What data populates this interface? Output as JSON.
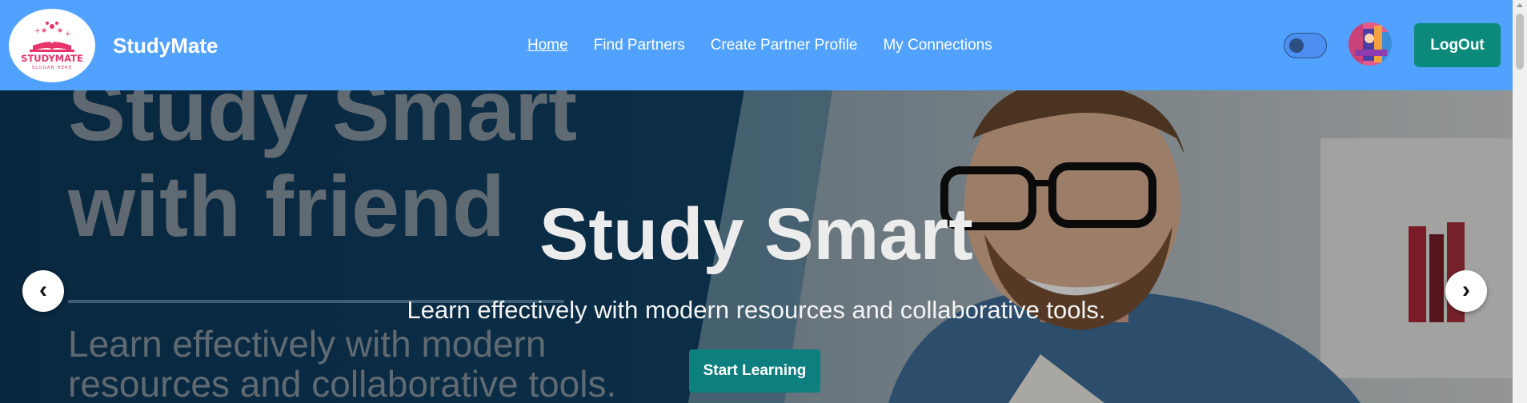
{
  "brand": {
    "name": "StudyMate",
    "logo_title": "STUDYMATE",
    "logo_slogan": "SLOGAN HERE"
  },
  "nav": {
    "items": [
      {
        "label": "Home",
        "active": true
      },
      {
        "label": "Find Partners",
        "active": false
      },
      {
        "label": "Create Partner Profile",
        "active": false
      },
      {
        "label": "My Connections",
        "active": false
      }
    ]
  },
  "header": {
    "theme_toggle": "toggle-icon",
    "avatar": "avatar",
    "logout_label": "LogOut"
  },
  "hero": {
    "title": "Study Smart",
    "subtitle": "Learn effectively with modern resources and collaborative tools.",
    "cta_label": "Start Learning",
    "prev_label": "‹",
    "next_label": "›",
    "background_text": {
      "line1": "Study Smart",
      "line2": "with friend",
      "sub1": "Learn effectively with modern",
      "sub2": "resources and collaborative tools."
    }
  },
  "colors": {
    "navbar": "#51a2ff",
    "logout": "#0b8a7c",
    "cta": "#0e7f7f",
    "logo_pink": "#e8336b"
  }
}
